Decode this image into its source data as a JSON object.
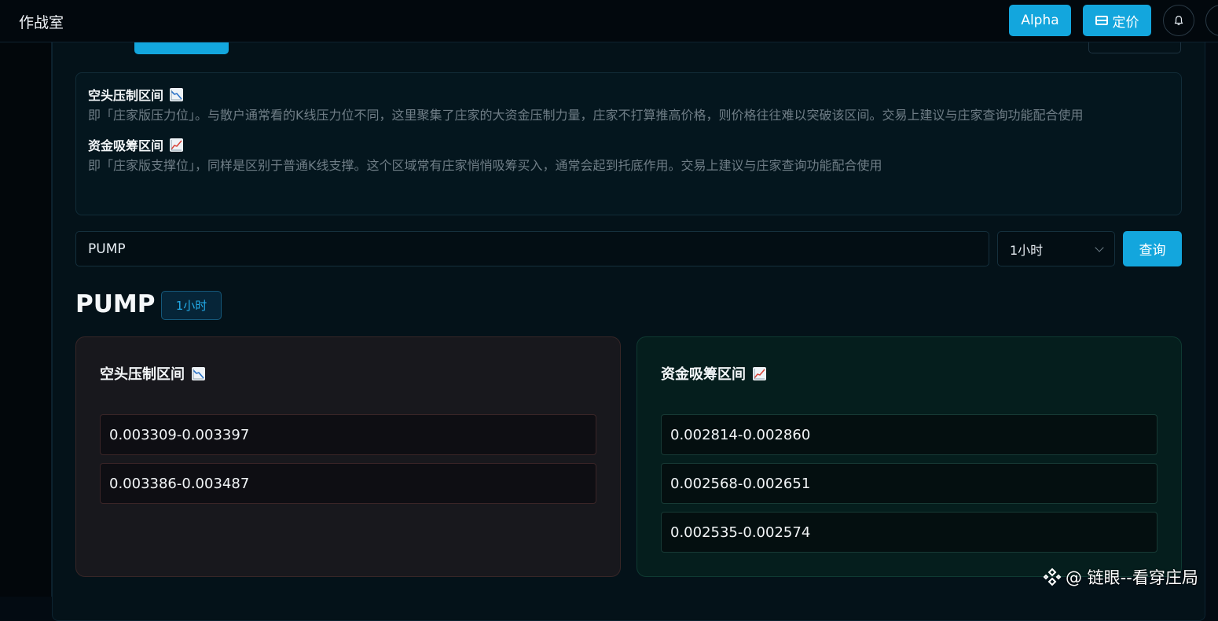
{
  "app": {
    "title": "作战室"
  },
  "topbar": {
    "alpha_label": "Alpha",
    "pricing_label": "定价"
  },
  "info": {
    "short_title": "空头压制区间",
    "short_desc": "即「庄家版压力位」。与散户通常看的K线压力位不同，这里聚集了庄家的大资金压制力量，庄家不打算推高价格，则价格往往难以突破该区间。交易上建议与庄家查询功能配合使用",
    "long_title": "资金吸筹区间",
    "long_desc": "即「庄家版支撑位」，同样是区别于普通K线支撑。这个区域常有庄家悄悄吸筹买入，通常会起到托底作用。交易上建议与庄家查询功能配合使用"
  },
  "query": {
    "symbol_value": "PUMP",
    "interval_value": "1小时",
    "submit_label": "查询"
  },
  "result": {
    "symbol": "PUMP",
    "interval_badge": "1小时",
    "short_zone": {
      "title": "空头压制区间",
      "ranges": [
        "0.003309-0.003397",
        "0.003386-0.003487"
      ]
    },
    "long_zone": {
      "title": "资金吸筹区间",
      "ranges": [
        "0.002814-0.002860",
        "0.002568-0.002651",
        "0.002535-0.002574"
      ]
    }
  },
  "watermark": {
    "text": "@ 链眼--看穿庄局"
  },
  "colors": {
    "accent": "#13a6dd",
    "short_card_bg": "#18181d",
    "long_card_bg": "#051e1d",
    "page_bg": "#030b12"
  }
}
